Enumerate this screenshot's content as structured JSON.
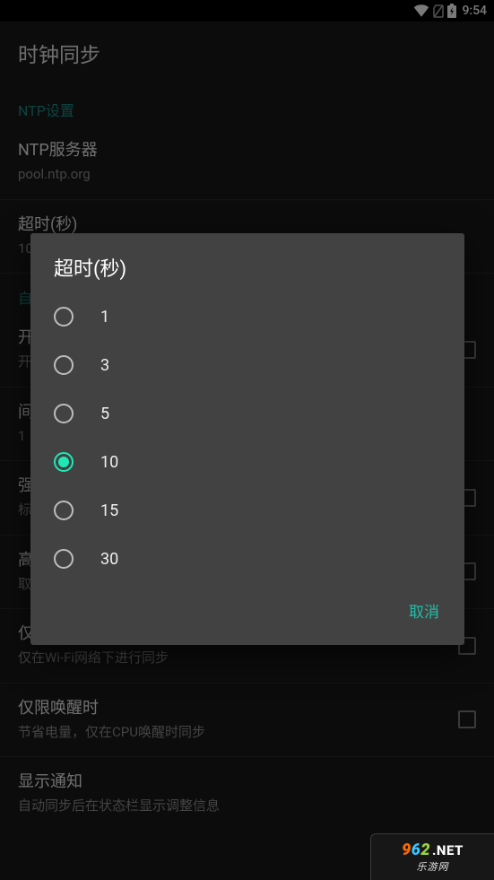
{
  "status": {
    "time": "9:54"
  },
  "app_title": "时钟同步",
  "section": {
    "ntp_label": "NTP设置",
    "auto_label": "自"
  },
  "rows": {
    "server": {
      "title": "NTP服务器",
      "sub": "pool.ntp.org"
    },
    "timeout": {
      "title": "超时(秒)",
      "sub": "10"
    },
    "enable": {
      "title": "开",
      "sub": "开"
    },
    "interval": {
      "title": "间",
      "sub": "1"
    },
    "force": {
      "title": "强",
      "sub": "标"
    },
    "high": {
      "title": "高",
      "sub": "取"
    },
    "wifi": {
      "title": "仅限Wi-Fi网络",
      "sub": "仅在Wi-Fi网络下进行同步"
    },
    "wake": {
      "title": "仅限唤醒时",
      "sub": "节省电量，仅在CPU唤醒时同步"
    },
    "notify": {
      "title": "显示通知",
      "sub": "自动同步后在状态栏显示调整信息"
    }
  },
  "dialog": {
    "title": "超时(秒)",
    "options": [
      "1",
      "3",
      "5",
      "10",
      "15",
      "30"
    ],
    "selected": "10",
    "cancel": "取消"
  },
  "watermark": {
    "d9": "9",
    "d6": "6",
    "d2": "2",
    "net": ".NET",
    "sub": "乐游网"
  }
}
